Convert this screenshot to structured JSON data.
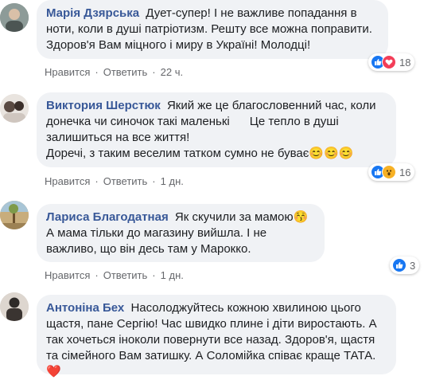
{
  "comments": [
    {
      "author": "Марія Дзярська",
      "text": "Дует-супер! І не важливе попадання в ноти, коли в душі патріотизм. Решту все можна поправити. Здоров'я Вам міцного і миру в Україні! Молодці!",
      "like_label": "Нравится",
      "reply_label": "Ответить",
      "time": "22 ч.",
      "reactions": [
        "like",
        "love"
      ],
      "reaction_count": "18"
    },
    {
      "author": "Виктория Шерстюк",
      "text": "Який же це благословенний час, коли донечка чи синочок такі маленькі      Це тепло в душі залишиться на все життя!\nДоречі, з таким веселим татком сумно не буває",
      "emoji_tail": "😊😊😊",
      "like_label": "Нравится",
      "reply_label": "Ответить",
      "time": "1 дн.",
      "reactions": [
        "like",
        "wow"
      ],
      "reaction_count": "16"
    },
    {
      "author": "Лариса Благодатная",
      "text": "Як скучили за мамою",
      "emoji_mid": "😚",
      "text_after": " А мама тільки до магазину вийшла. І не важливо, що він десь там у Марокко.",
      "like_label": "Нравится",
      "reply_label": "Ответить",
      "time": "1 дн.",
      "reactions": [
        "like"
      ],
      "reaction_count": "3"
    },
    {
      "author": "Антоніна Бех",
      "text": "Насолоджуйтесь кожною хвилиною цього щастя, пане Сергію! Час швидко плине і діти виростають. А так хочеться іноколи повернути все назад. Здоров'я, щастя та сімейного Вам затишку. А Соломійка співає краще ТАТА.",
      "emoji_tail": "❤️"
    }
  ],
  "colors": {
    "author": "#385898",
    "bubble": "#f0f2f5",
    "meta": "#65676b",
    "like": "#1877f2",
    "love": "#f33e58",
    "wow": "#f7b125"
  }
}
